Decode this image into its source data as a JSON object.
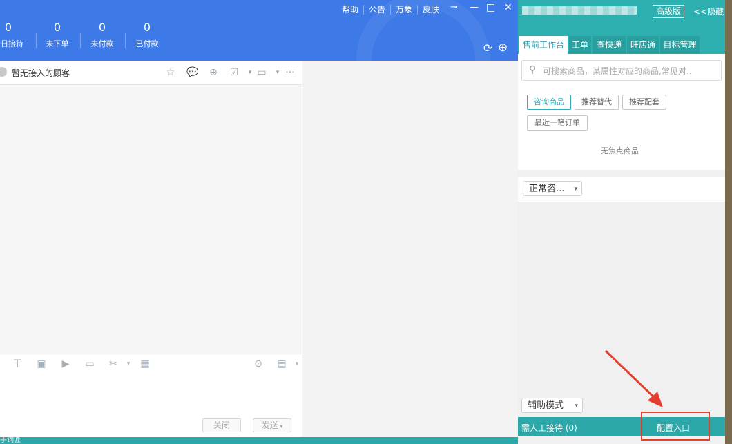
{
  "header": {
    "menu": [
      "帮助",
      "公告",
      "万象",
      "皮肤"
    ],
    "stats": [
      {
        "value": "0",
        "label": "今日接待"
      },
      {
        "value": "0",
        "label": "未下单"
      },
      {
        "value": "0",
        "label": "未付款"
      },
      {
        "value": "0",
        "label": "已付款"
      }
    ]
  },
  "chat": {
    "title": "暂无接入的顾客",
    "close_label": "关闭",
    "send_label": "发送"
  },
  "right_panel": {
    "version_label": "高级版",
    "hide_label": "<<隐藏",
    "tabs": [
      "售前工作台",
      "工单",
      "查快递",
      "旺店通",
      "目标管理"
    ],
    "search_placeholder": "可搜索商品，某属性对应的商品,常见对..",
    "chips": [
      "咨询商品",
      "推荐替代",
      "推荐配套",
      "最近一笔订单"
    ],
    "no_focus": "无焦点商品",
    "consult_select": "正常咨...",
    "mode_select": "辅助模式",
    "waiting_label": "需人工接待 (0)",
    "config_label": "配置入口"
  },
  "footer_text": "手词匠",
  "colors": {
    "header_blue": "#3d7ae7",
    "teal": "#2eb0b0",
    "highlight_red": "#e53d2e"
  }
}
